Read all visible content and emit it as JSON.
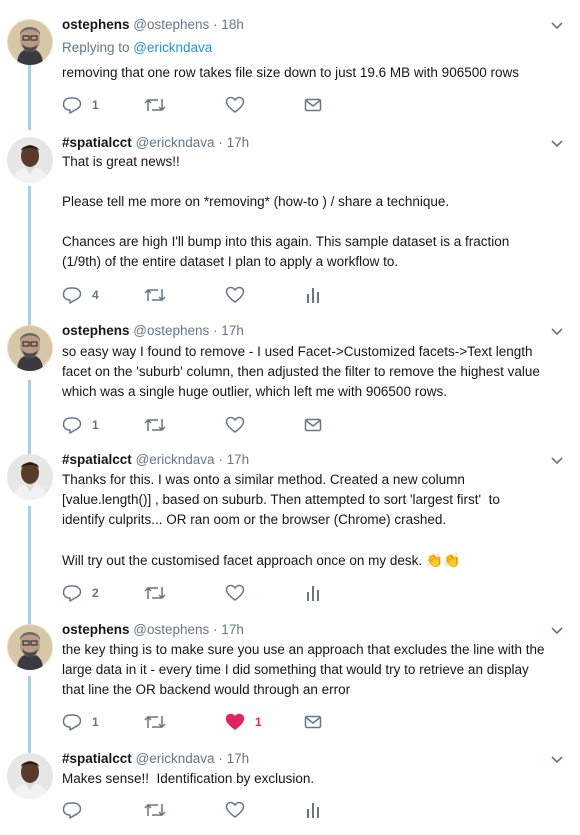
{
  "tweets": [
    {
      "name": "ostephens",
      "handle": "@ostephens",
      "time": "· 18h",
      "replying_to_prefix": "Replying to ",
      "replying_to": "@erickndava",
      "text": "removing that one row takes file size down to just 19.6 MB with 906500 rows",
      "reply_count": "1",
      "retweet_count": "",
      "like_count": "",
      "fifth_icon": "envelope-icon"
    },
    {
      "name": "#spatialcct",
      "handle": "@erickndava",
      "time": "· 17h",
      "text": "That is great news!!\n\nPlease tell me more on *removing* (how-to ) / share a technique.\n\nChances are high I'll bump into this again. This sample dataset is a fraction\n(1/9th) of the entire dataset I plan to apply a workflow to.",
      "reply_count": "4",
      "retweet_count": "",
      "like_count": "",
      "fifth_icon": "analytics-icon"
    },
    {
      "name": "ostephens",
      "handle": "@ostephens",
      "time": "· 17h",
      "text": "so easy way I found to remove - I used Facet->Customized facets->Text length\nfacet on the 'suburb' column, then adjusted the filter to remove the highest value\nwhich was a single huge outlier, which left me with 906500 rows.",
      "reply_count": "1",
      "retweet_count": "",
      "like_count": "",
      "fifth_icon": "envelope-icon"
    },
    {
      "name": "#spatialcct",
      "handle": "@erickndava",
      "time": "· 17h",
      "text": "Thanks for this. I was onto a similar method. Created a new column\n[value.length()] , based on suburb. Then attempted to sort 'largest first'  to\nidentify culprits... OR ran oom or the browser (Chrome) crashed.\n\nWill try out the customised facet approach once on my desk. ",
      "emoji": "👏👏",
      "reply_count": "2",
      "retweet_count": "",
      "like_count": "",
      "fifth_icon": "analytics-icon"
    },
    {
      "name": "ostephens",
      "handle": "@ostephens",
      "time": "· 17h",
      "text": "the key thing is to make sure you use an approach that excludes the line with the\nlarge data in it - every time I did something that would try to retrieve an display\nthat line the OR backend would through an error",
      "reply_count": "1",
      "retweet_count": "",
      "like_count": "1",
      "liked": true,
      "fifth_icon": "envelope-icon"
    },
    {
      "name": "#spatialcct",
      "handle": "@erickndava",
      "time": "· 17h",
      "text": "Makes sense!!  Identification by exclusion.",
      "reply_count": "",
      "retweet_count": "",
      "like_count": "",
      "fifth_icon": "analytics-icon"
    }
  ],
  "colors": {
    "accent": "#1b95e0",
    "muted": "#657786",
    "like": "#e0245e",
    "thread_line": "#a6d0e6"
  }
}
